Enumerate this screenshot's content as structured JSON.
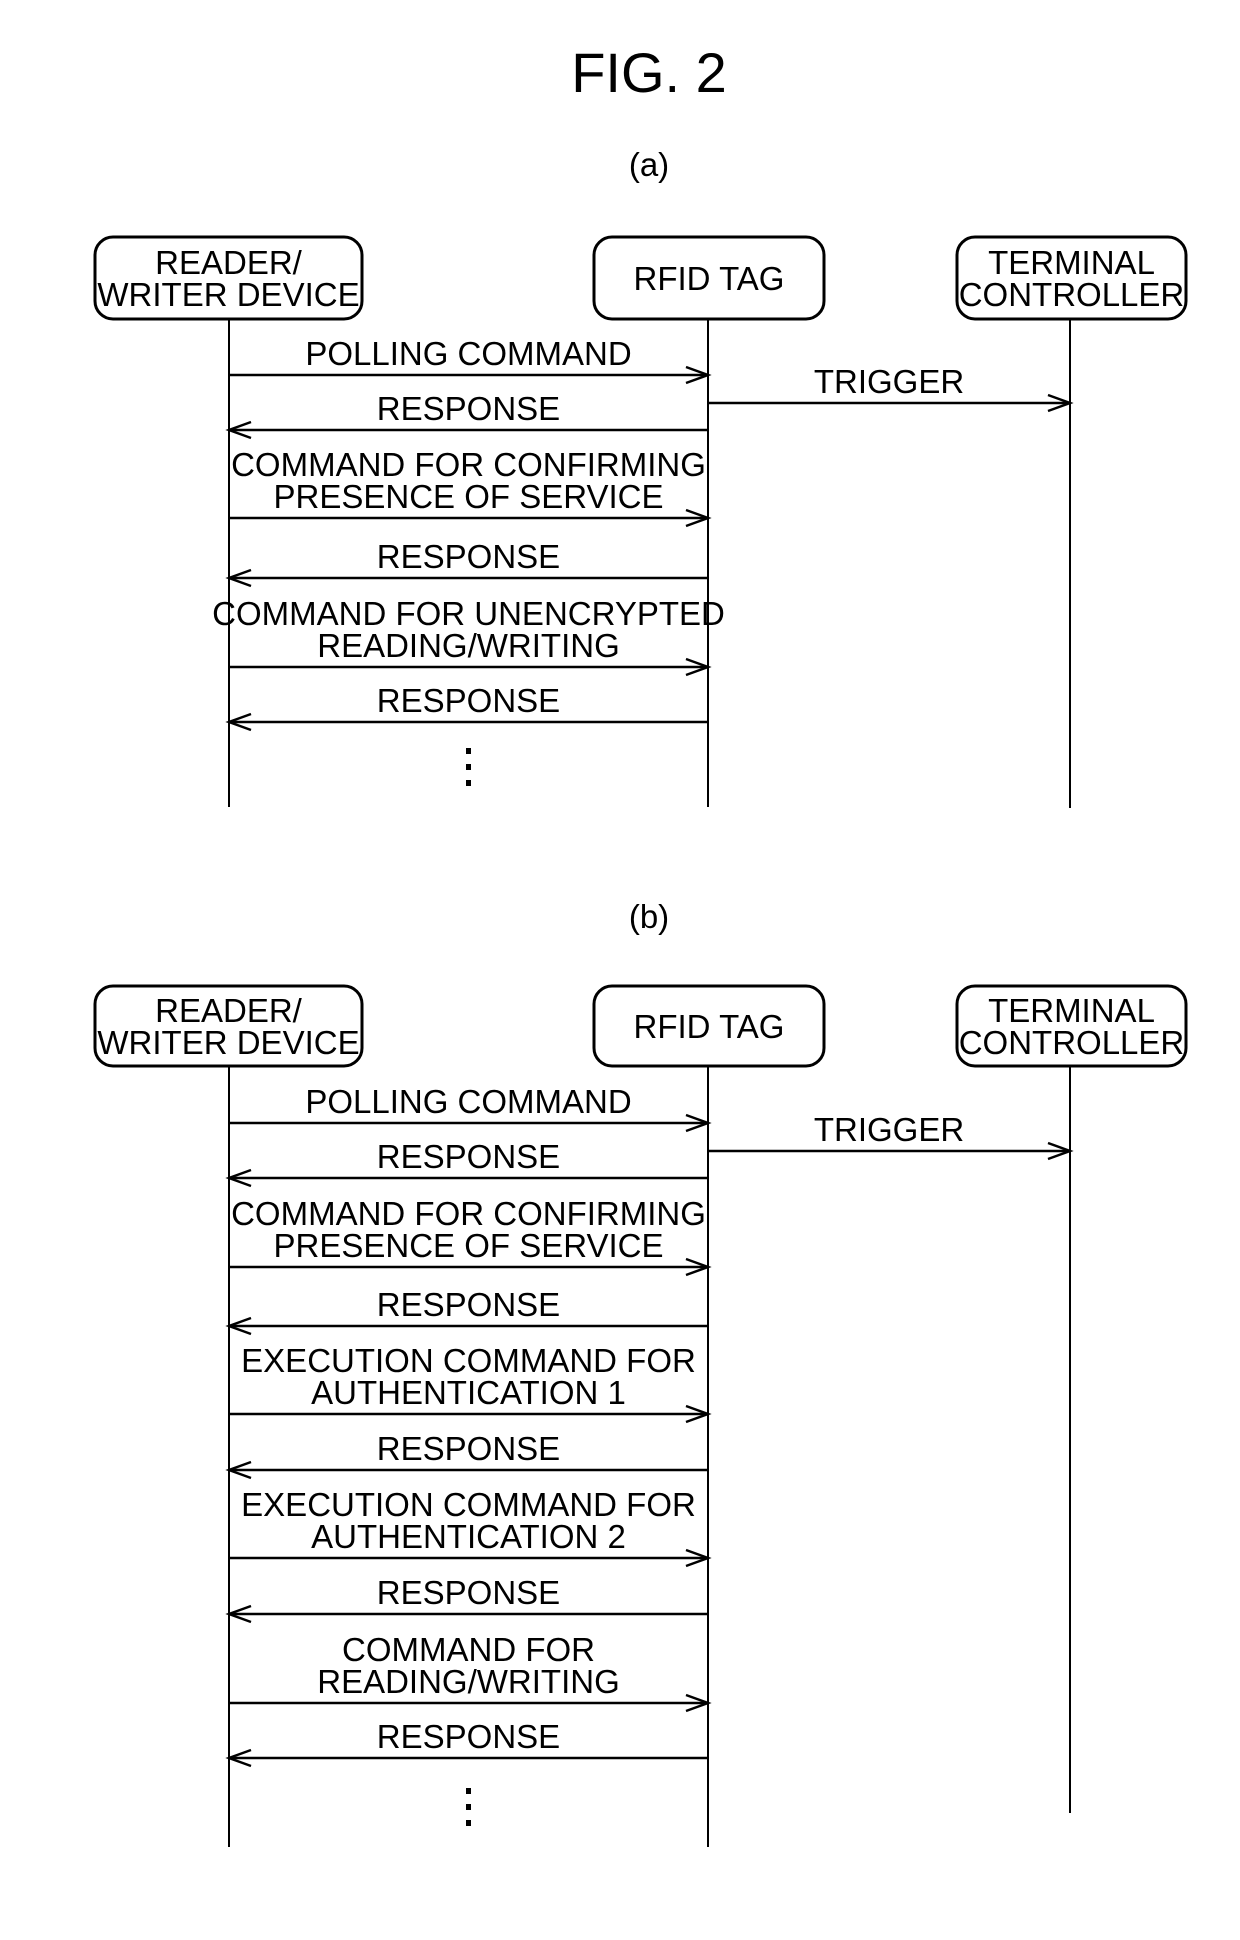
{
  "figure": {
    "title": "FIG. 2",
    "panels": [
      {
        "label": "(a)",
        "participants": [
          {
            "id": "rw",
            "lines": [
              "READER/",
              "WRITER DEVICE"
            ]
          },
          {
            "id": "tag",
            "lines": [
              "RFID TAG"
            ]
          },
          {
            "id": "tc",
            "lines": [
              "TERMINAL",
              "CONTROLLER"
            ]
          }
        ],
        "messages": [
          {
            "from": "rw",
            "to": "tag",
            "lines": [
              "POLLING COMMAND"
            ]
          },
          {
            "from": "tag",
            "to": "tc",
            "lines": [
              "TRIGGER"
            ]
          },
          {
            "from": "tag",
            "to": "rw",
            "lines": [
              "RESPONSE"
            ]
          },
          {
            "from": "rw",
            "to": "tag",
            "lines": [
              "COMMAND FOR CONFIRMING",
              "PRESENCE OF SERVICE"
            ]
          },
          {
            "from": "tag",
            "to": "rw",
            "lines": [
              "RESPONSE"
            ]
          },
          {
            "from": "rw",
            "to": "tag",
            "lines": [
              "COMMAND FOR UNENCRYPTED",
              "READING/WRITING"
            ]
          },
          {
            "from": "tag",
            "to": "rw",
            "lines": [
              "RESPONSE"
            ]
          }
        ],
        "continuation": "⋮"
      },
      {
        "label": "(b)",
        "participants": [
          {
            "id": "rw",
            "lines": [
              "READER/",
              "WRITER DEVICE"
            ]
          },
          {
            "id": "tag",
            "lines": [
              "RFID TAG"
            ]
          },
          {
            "id": "tc",
            "lines": [
              "TERMINAL",
              "CONTROLLER"
            ]
          }
        ],
        "messages": [
          {
            "from": "rw",
            "to": "tag",
            "lines": [
              "POLLING COMMAND"
            ]
          },
          {
            "from": "tag",
            "to": "tc",
            "lines": [
              "TRIGGER"
            ]
          },
          {
            "from": "tag",
            "to": "rw",
            "lines": [
              "RESPONSE"
            ]
          },
          {
            "from": "rw",
            "to": "tag",
            "lines": [
              "COMMAND FOR CONFIRMING",
              "PRESENCE OF SERVICE"
            ]
          },
          {
            "from": "tag",
            "to": "rw",
            "lines": [
              "RESPONSE"
            ]
          },
          {
            "from": "rw",
            "to": "tag",
            "lines": [
              "EXECUTION COMMAND FOR",
              "AUTHENTICATION 1"
            ]
          },
          {
            "from": "tag",
            "to": "rw",
            "lines": [
              "RESPONSE"
            ]
          },
          {
            "from": "rw",
            "to": "tag",
            "lines": [
              "EXECUTION COMMAND FOR",
              "AUTHENTICATION 2"
            ]
          },
          {
            "from": "tag",
            "to": "rw",
            "lines": [
              "RESPONSE"
            ]
          },
          {
            "from": "rw",
            "to": "tag",
            "lines": [
              "COMMAND FOR",
              "READING/WRITING"
            ]
          },
          {
            "from": "tag",
            "to": "rw",
            "lines": [
              "RESPONSE"
            ]
          }
        ],
        "continuation": "⋮"
      }
    ]
  }
}
